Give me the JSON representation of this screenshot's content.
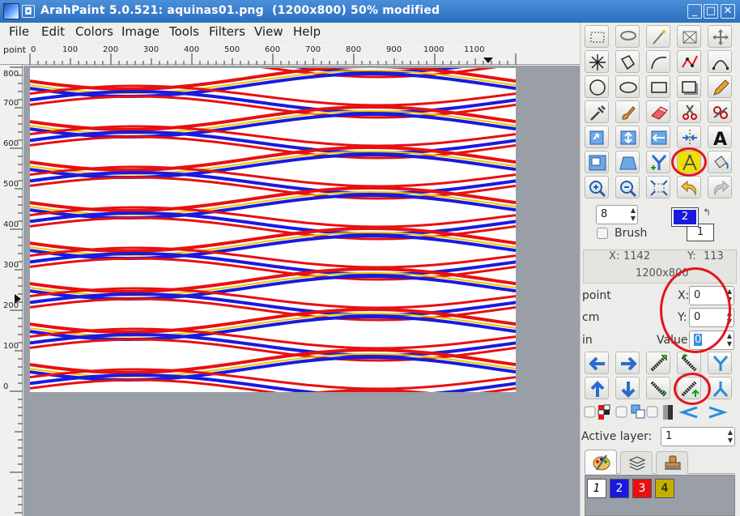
{
  "window": {
    "title": "ArahPaint 5.0.521: aquinas01.png  (1200x800) 50% modified",
    "controls": [
      "_",
      "□",
      "✕"
    ]
  },
  "menubar": [
    "File",
    "Edit",
    "Colors",
    "Image",
    "Tools",
    "Filters",
    "View",
    "Help"
  ],
  "ruler": {
    "unit": "point",
    "top_labels": [
      "0",
      "100",
      "200",
      "300",
      "400",
      "500",
      "600",
      "700",
      "800",
      "900",
      "1000",
      "1100"
    ],
    "left_labels": [
      "800",
      "700",
      "600",
      "500",
      "400",
      "300",
      "200",
      "100",
      "0"
    ]
  },
  "tools": {
    "rows": [
      [
        "select-rect",
        "lasso",
        "magic-wand",
        "crop",
        "move"
      ],
      [
        "star",
        "polygon",
        "curve",
        "path-red",
        "bezier"
      ],
      [
        "ellipse-empty",
        "ellipse",
        "rectangle",
        "rectangle-shadow",
        "pencil"
      ],
      [
        "eyedropper",
        "brush",
        "eraser",
        "scissors",
        "clone"
      ],
      [
        "transform-rotate",
        "stretch-vertical",
        "flip-horizontal",
        "insert-row",
        "text"
      ],
      [
        "resize",
        "perspective",
        "y-split",
        "compass",
        "fill-bucket"
      ],
      [
        "zoom-in",
        "zoom-out",
        "fit-screen",
        "undo",
        "redo"
      ]
    ]
  },
  "brush": {
    "size": "8",
    "label": "Brush",
    "fg_color_index": "2",
    "bg_color_index": "1",
    "fg_color": "#1a1adf",
    "bg_color": "#ffffff"
  },
  "coords": {
    "x_label": "X:",
    "x_value": "1142",
    "y_label": "Y:",
    "y_value": "113",
    "size": "1200x800"
  },
  "units": [
    "point",
    "cm",
    "in"
  ],
  "offset": {
    "x_label": "X:",
    "x_value": "0",
    "y_label": "Y:",
    "y_value": "0",
    "value_label": "Value",
    "value_value": "0"
  },
  "active_layer": {
    "label": "Active layer:",
    "value": "1"
  },
  "layers": [
    {
      "label": "1",
      "color": "#ffffff",
      "text_color": "#000000"
    },
    {
      "label": "2",
      "color": "#1a1adf",
      "text_color": "#ffffff"
    },
    {
      "label": "3",
      "color": "#e81010",
      "text_color": "#ffffff"
    },
    {
      "label": "4",
      "color": "#c4b000",
      "text_color": "#000000"
    }
  ],
  "colors": {
    "red": "#e81010",
    "blue": "#1a1adf",
    "yellow": "#e8c800",
    "annotation": "#e4141c"
  }
}
